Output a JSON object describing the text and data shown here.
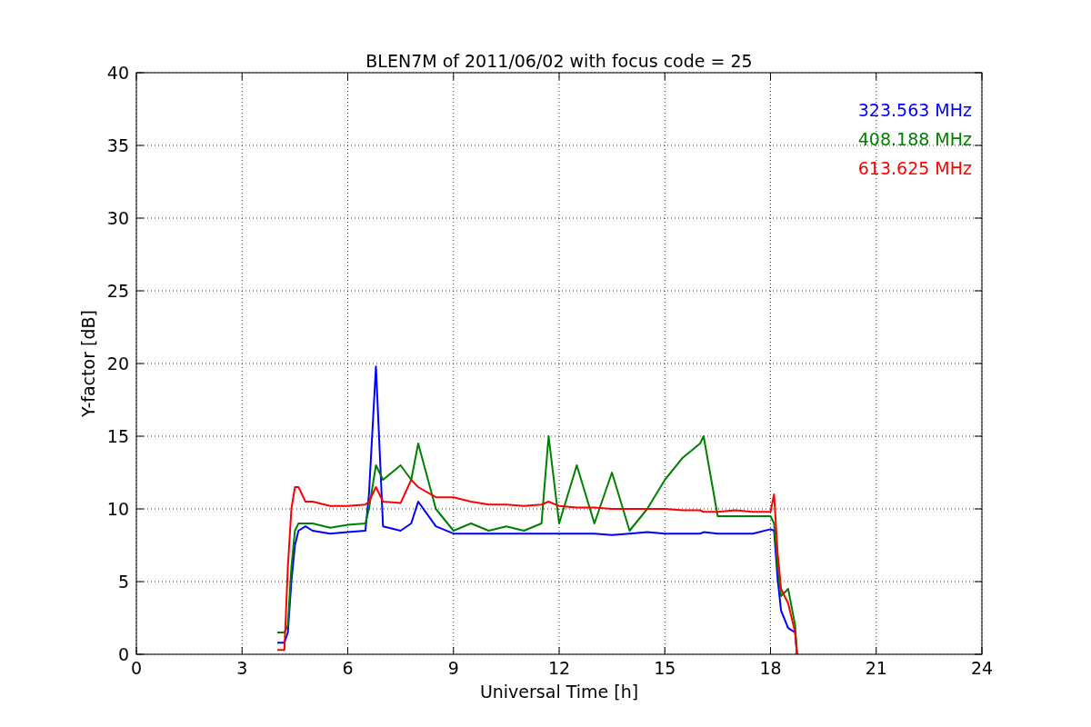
{
  "chart_data": {
    "type": "line",
    "title": "BLEN7M of 2011/06/02 with focus code = 25",
    "xlabel": "Universal Time [h]",
    "ylabel": "Y-factor [dB]",
    "x": [
      4.0,
      4.2,
      4.3,
      4.4,
      4.5,
      4.6,
      4.8,
      5.0,
      5.5,
      6.0,
      6.5,
      6.6,
      6.8,
      7.0,
      7.5,
      7.8,
      8.0,
      8.5,
      9.0,
      9.5,
      10,
      10.5,
      11,
      11.5,
      11.7,
      12,
      12.5,
      13,
      13.5,
      14,
      14.5,
      15,
      15.5,
      16,
      16.1,
      16.5,
      17,
      17.5,
      18,
      18.1,
      18.2,
      18.3,
      18.5,
      18.7,
      18.75
    ],
    "series": [
      {
        "name": "323.563 MHz",
        "color": "#0000ff",
        "values": [
          0.8,
          0.8,
          1.5,
          5,
          7.5,
          8.5,
          8.8,
          8.5,
          8.3,
          8.4,
          8.5,
          11,
          19.8,
          8.8,
          8.5,
          9,
          10.5,
          8.8,
          8.3,
          8.3,
          8.3,
          8.3,
          8.3,
          8.3,
          8.3,
          8.3,
          8.3,
          8.3,
          8.2,
          8.3,
          8.4,
          8.3,
          8.3,
          8.3,
          8.4,
          8.3,
          8.3,
          8.3,
          8.6,
          8.5,
          5.2,
          3,
          1.8,
          1.5,
          0
        ]
      },
      {
        "name": "408.188 MHz",
        "color": "#008000",
        "values": [
          1.5,
          1.5,
          2,
          6,
          8.5,
          9,
          9,
          9,
          8.7,
          8.9,
          9,
          10,
          13,
          12,
          13,
          12,
          14.5,
          10,
          8.5,
          9,
          8.5,
          8.8,
          8.5,
          9,
          15,
          9,
          13,
          9,
          12.5,
          8.5,
          10,
          12,
          13.5,
          14.5,
          15,
          9.5,
          9.5,
          9.5,
          9.5,
          9,
          6,
          4,
          4.5,
          2,
          0
        ]
      },
      {
        "name": "613.625 MHz",
        "color": "#ff0000",
        "values": [
          0.3,
          0.3,
          6,
          10,
          11.5,
          11.5,
          10.5,
          10.5,
          10.2,
          10.2,
          10.3,
          10.5,
          11.5,
          10.5,
          10.4,
          12,
          11.5,
          10.8,
          10.8,
          10.5,
          10.3,
          10.3,
          10.2,
          10.3,
          10.5,
          10.2,
          10.1,
          10.1,
          10,
          10,
          10,
          10,
          9.9,
          9.9,
          9.8,
          9.8,
          9.9,
          9.8,
          9.8,
          11,
          7,
          4.5,
          3.5,
          1.5,
          0
        ]
      }
    ],
    "grid": true,
    "xlim": [
      0,
      24
    ],
    "ylim": [
      0,
      40
    ],
    "xticks": [
      0,
      3,
      6,
      9,
      12,
      15,
      18,
      21,
      24
    ],
    "yticks": [
      0,
      5,
      10,
      15,
      20,
      25,
      30,
      35,
      40
    ]
  }
}
